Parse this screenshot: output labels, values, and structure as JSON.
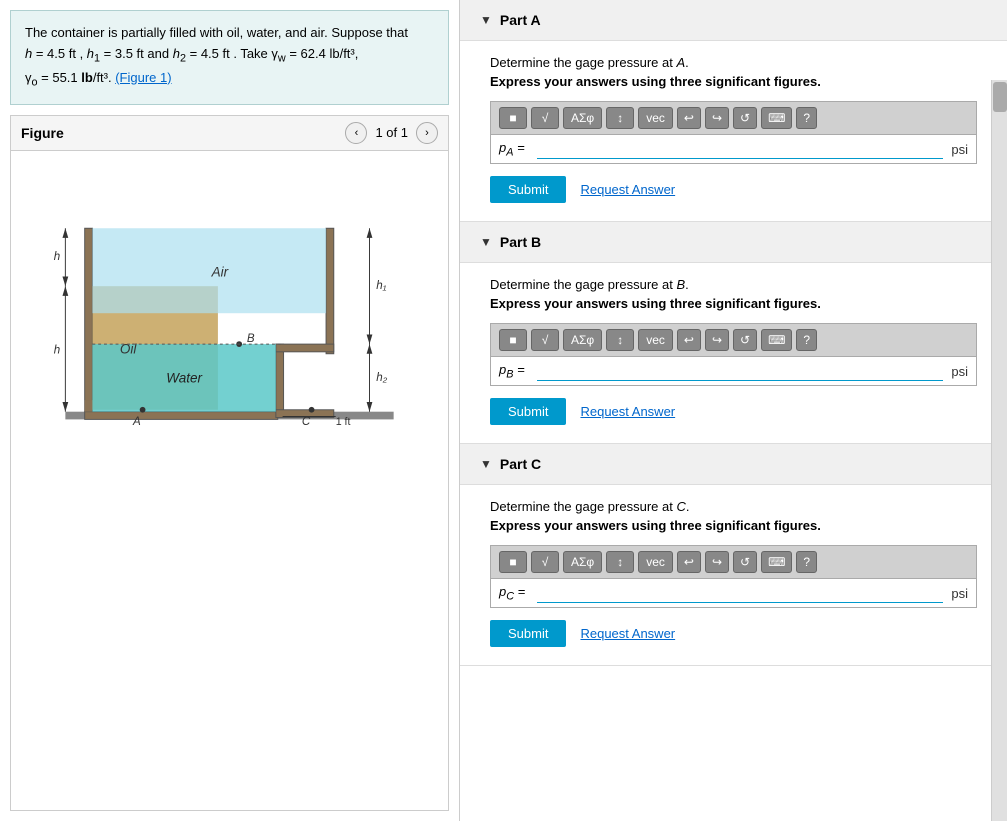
{
  "problem": {
    "text": "The container is partially filled with oil, water, and air. Suppose that",
    "variables": "h = 4.5 ft , h₁ = 3.5 ft and h₂ = 4.5 ft . Take γw = 62.4 lb/ft³,",
    "gamma_o": "γo = 55.1 lb/ft³.",
    "figure_link": "(Figure 1)"
  },
  "figure": {
    "title": "Figure",
    "nav_text": "1 of 1",
    "prev_label": "‹",
    "next_label": "›"
  },
  "parts": [
    {
      "id": "A",
      "title": "Part A",
      "determine_text": "Determine the gage pressure at A.",
      "sig_fig_text": "Express your answers using three significant figures.",
      "label": "pA =",
      "unit": "psi",
      "submit_label": "Submit",
      "request_label": "Request Answer",
      "toolbar": {
        "sqrt_label": "√",
        "aze_label": "AΣφ",
        "arrow_label": "↕",
        "vec_label": "vec",
        "undo_label": "↩",
        "redo_label": "↪",
        "refresh_label": "↺",
        "kbd_label": "⌨",
        "help_label": "?"
      }
    },
    {
      "id": "B",
      "title": "Part B",
      "determine_text": "Determine the gage pressure at B.",
      "sig_fig_text": "Express your answers using three significant figures.",
      "label": "pB =",
      "unit": "psi",
      "submit_label": "Submit",
      "request_label": "Request Answer",
      "toolbar": {
        "sqrt_label": "√",
        "aze_label": "AΣφ",
        "arrow_label": "↕",
        "vec_label": "vec",
        "undo_label": "↩",
        "redo_label": "↪",
        "refresh_label": "↺",
        "kbd_label": "⌨",
        "help_label": "?"
      }
    },
    {
      "id": "C",
      "title": "Part C",
      "determine_text": "Determine the gage pressure at C.",
      "sig_fig_text": "Express your answers using three significant figures.",
      "label": "pC =",
      "unit": "psi",
      "submit_label": "Submit",
      "request_label": "Request Answer",
      "toolbar": {
        "sqrt_label": "√",
        "aze_label": "AΣφ",
        "arrow_label": "↕",
        "vec_label": "vec",
        "undo_label": "↩",
        "redo_label": "↪",
        "refresh_label": "↺",
        "kbd_label": "⌨",
        "help_label": "?"
      }
    }
  ],
  "colors": {
    "teal_header": "#d5e8e8",
    "part_header_bg": "#f0f0f0",
    "submit_bg": "#0099cc",
    "input_border": "#0099cc"
  }
}
